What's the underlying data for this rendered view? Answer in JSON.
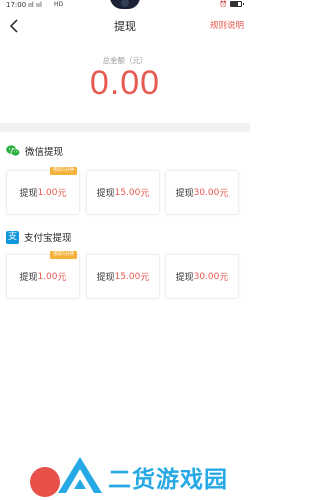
{
  "status_bar": {
    "time": "17:00",
    "signal": "ııl ııl",
    "network": "HD",
    "battery_level": 0.7
  },
  "nav": {
    "title": "提现",
    "rules_label": "规则说明"
  },
  "summary": {
    "total_label": "总金额（元）",
    "total_amount": "0.00"
  },
  "sections": [
    {
      "title": "微信提现",
      "icon": "wechat-icon",
      "options": [
        {
          "label": "提现",
          "amount": "1.00",
          "unit": "元",
          "badge": "限前5分钟"
        },
        {
          "label": "提现",
          "amount": "15.00",
          "unit": "元",
          "badge": ""
        },
        {
          "label": "提现",
          "amount": "30.00",
          "unit": "元",
          "badge": ""
        }
      ]
    },
    {
      "title": "支付宝提现",
      "icon": "alipay-icon",
      "icon_glyph": "支",
      "options": [
        {
          "label": "提现",
          "amount": "1.00",
          "unit": "元",
          "badge": "限前5分钟"
        },
        {
          "label": "提现",
          "amount": "15.00",
          "unit": "元",
          "badge": ""
        },
        {
          "label": "提现",
          "amount": "30.00",
          "unit": "元",
          "badge": ""
        }
      ]
    }
  ],
  "watermark": {
    "text": "二货游戏园"
  },
  "colors": {
    "accent": "#e8574f",
    "badge": "#f5b13a",
    "wechat": "#2aae3d",
    "alipay": "#1296db",
    "watermark": "#27a9e6"
  }
}
